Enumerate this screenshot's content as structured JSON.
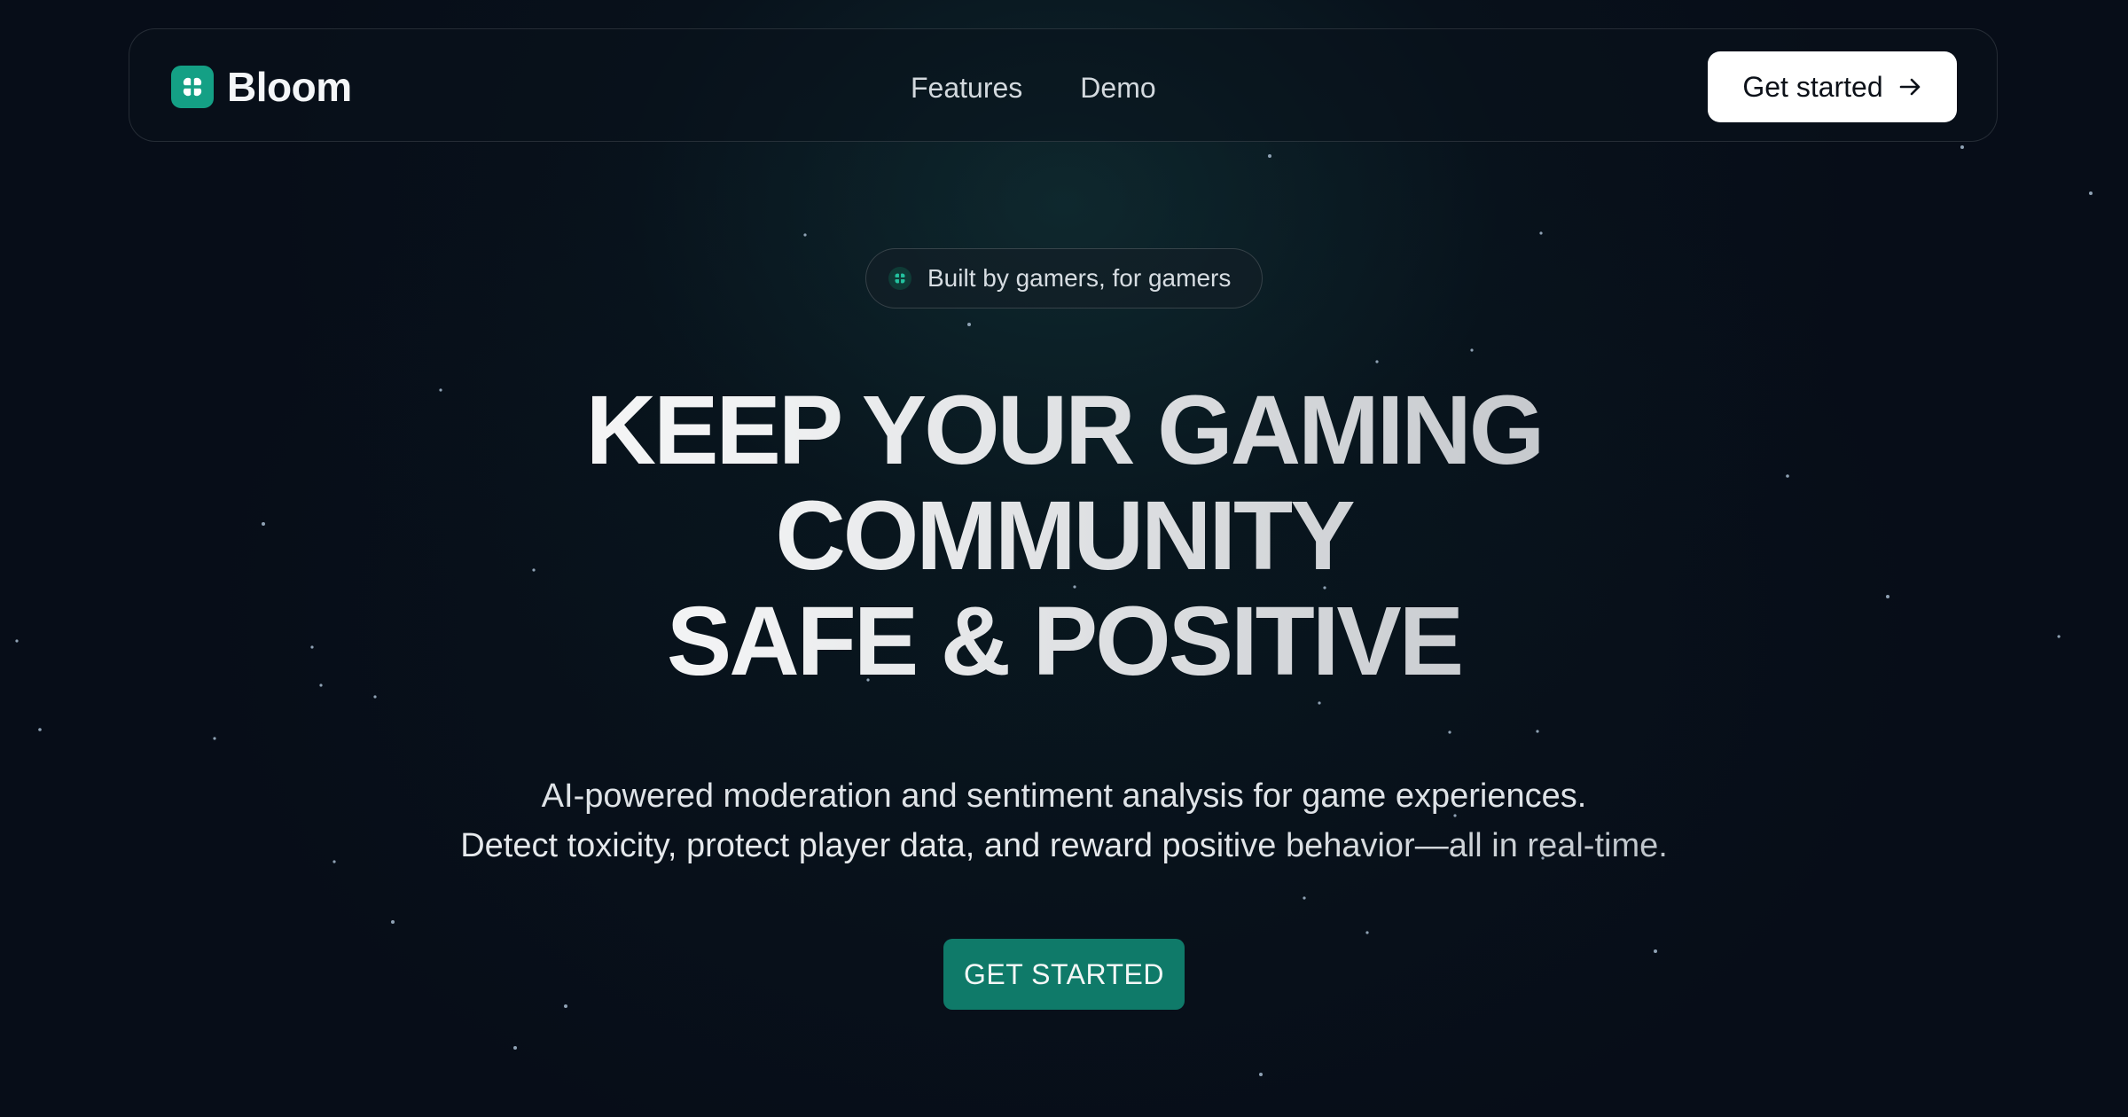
{
  "nav": {
    "brand": "Bloom",
    "links": [
      "Features",
      "Demo"
    ],
    "cta_label": "Get started"
  },
  "hero": {
    "badge": "Built by gamers, for gamers",
    "headline": [
      "KEEP YOUR GAMING",
      "COMMUNITY",
      "SAFE & POSITIVE"
    ],
    "subtitle": [
      "AI-powered moderation and sentiment analysis for game experiences.",
      "Detect toxicity, protect player data, and reward positive behavior—all in real-time."
    ],
    "cta_label": "GET STARTED"
  },
  "colors": {
    "background": "#070d18",
    "accent": "#14a085",
    "cta": "#0f7a69",
    "nav_cta": "#ffffff"
  },
  "icons": {
    "logo": "clover-icon",
    "nav_cta": "arrow-right-icon",
    "badge": "clover-icon"
  }
}
